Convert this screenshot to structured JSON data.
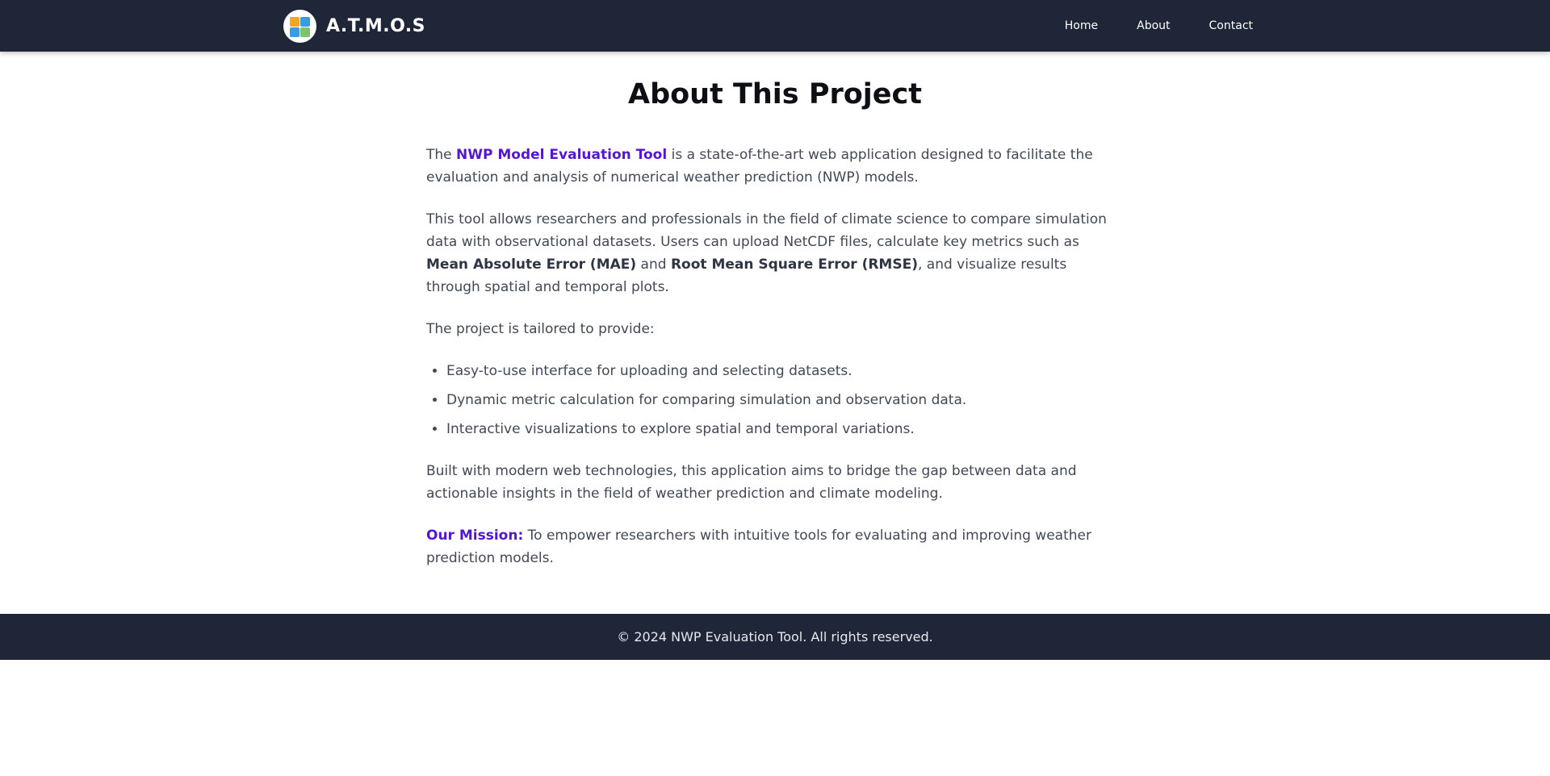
{
  "navbar": {
    "brand": "A.T.M.O.S",
    "logo_icon": "weather-quadrant-logo-icon",
    "links": [
      "Home",
      "About",
      "Contact"
    ]
  },
  "main": {
    "title": "About This Project",
    "p1": {
      "pre": "The ",
      "highlight": "NWP Model Evaluation Tool",
      "post": " is a state-of-the-art web application designed to facilitate the evaluation and analysis of numerical weather prediction (NWP) models."
    },
    "p2": {
      "t1": "This tool allows researchers and professionals in the field of climate science to compare simulation data with observational datasets. Users can upload NetCDF files, calculate key metrics such as ",
      "b1": "Mean Absolute Error (MAE)",
      "t2": " and ",
      "b2": "Root Mean Square Error (RMSE)",
      "t3": ", and visualize results through spatial and temporal plots."
    },
    "p3": "The project is tailored to provide:",
    "bullets": [
      "Easy-to-use interface for uploading and selecting datasets.",
      "Dynamic metric calculation for comparing simulation and observation data.",
      "Interactive visualizations to explore spatial and temporal variations."
    ],
    "p4": "Built with modern web technologies, this application aims to bridge the gap between data and actionable insights in the field of weather prediction and climate modeling.",
    "mission": {
      "label": "Our Mission:",
      "text": " To empower researchers with intuitive tools for evaluating and improving weather prediction models."
    }
  },
  "footer": {
    "text": "© 2024 NWP Evaluation Tool. All rights reserved."
  },
  "colors": {
    "navbar_bg": "#1f2638",
    "accent": "#5316d4",
    "body_text": "#414857"
  }
}
